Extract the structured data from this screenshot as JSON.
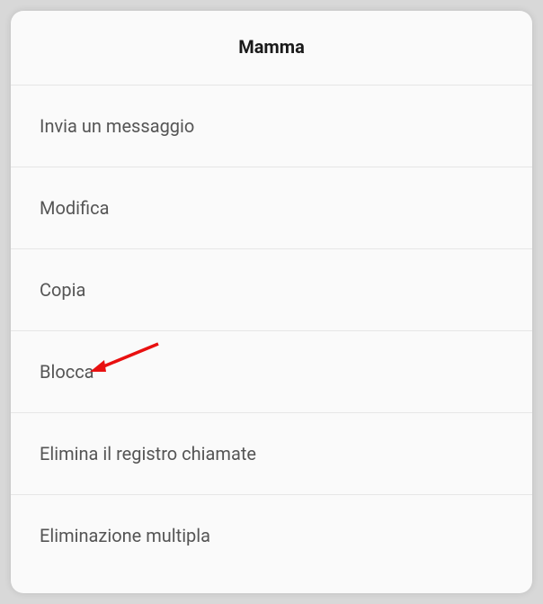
{
  "header": {
    "title": "Mamma"
  },
  "menu": {
    "items": [
      {
        "label": "Invia un messaggio",
        "id": "send-message"
      },
      {
        "label": "Modifica",
        "id": "edit"
      },
      {
        "label": "Copia",
        "id": "copy"
      },
      {
        "label": "Blocca",
        "id": "block"
      },
      {
        "label": "Elimina il registro chiamate",
        "id": "delete-call-log"
      },
      {
        "label": "Eliminazione multipla",
        "id": "multi-delete"
      }
    ]
  }
}
